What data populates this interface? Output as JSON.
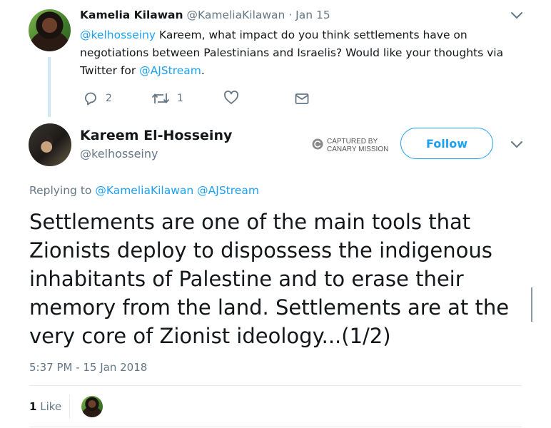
{
  "tweet1": {
    "name": "Kamelia Kilawan",
    "handle": "@KameliaKilawan",
    "date": "· Jan 15",
    "mention": "@kelhosseiny",
    "text_line1": " Kareem, what impact do you think settlements have on",
    "text_line2": "negotiations between Palestinians and Israelis? Would like your thoughts via",
    "text_line3_pre": "Twitter for ",
    "text_line3_link": "@AJStream",
    "text_line3_post": ".",
    "reply_count": "2",
    "retweet_count": "1"
  },
  "tweet2": {
    "name": "Kareem El-Hosseiny",
    "handle": "@kelhosseiny",
    "badge_line1": "CAPTURED BY",
    "badge_line2": "CANARY MISSION",
    "follow_label": "Follow",
    "replying_prefix": "Replying to ",
    "replying_to_1": "@KameliaKilawan",
    "replying_to_2": "@AJStream",
    "body_line1": "Settlements are one of the main tools that",
    "body_line2": "Zionists deploy to dispossess the indigenous",
    "body_line3": "inhabitants of Palestine and to erase their",
    "body_line4": "memory from the land. Settlements are at the",
    "body_line5": "very core of Zionist ideology...(1/2)",
    "timestamp": "5:37 PM - 15 Jan 2018",
    "likes_count": "1",
    "likes_label": "Like"
  },
  "icons": {
    "reply": "reply-icon",
    "retweet": "retweet-icon",
    "like": "heart-icon",
    "dm": "envelope-icon",
    "menu": "chevron-down-icon",
    "badge": "canary-badge-icon"
  },
  "colors": {
    "accent": "#1da1f2",
    "muted": "#657786",
    "text": "#14171a",
    "thread_line": "#cde9f5"
  }
}
